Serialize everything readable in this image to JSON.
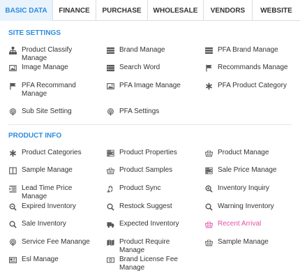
{
  "tabs": [
    {
      "label": "BASIC DATA"
    },
    {
      "label": "FINANCE"
    },
    {
      "label": "PURCHASE"
    },
    {
      "label": "WHOLESALE"
    },
    {
      "label": "VENDORS"
    },
    {
      "label": "WEBSITE"
    }
  ],
  "site_settings": {
    "title": "SITE SETTINGS",
    "items": [
      {
        "label": "Product Classify Manage",
        "icon": "sitemap-icon"
      },
      {
        "label": "Brand Manage",
        "icon": "list-icon"
      },
      {
        "label": "PFA Brand Manage",
        "icon": "list-icon"
      },
      {
        "label": "Image Manage",
        "icon": "image-icon"
      },
      {
        "label": "Search Word",
        "icon": "list-bullet-icon"
      },
      {
        "label": "Recommands Manage",
        "icon": "flag-icon"
      },
      {
        "label": "PFA Recommand Manage",
        "icon": "flag-icon"
      },
      {
        "label": "PFA Image Manage",
        "icon": "image-icon"
      },
      {
        "label": "PFA Product Category",
        "icon": "asterisk-icon"
      },
      {
        "label": "Sub Site Setting",
        "icon": "podcast-icon"
      },
      {
        "label": "PFA Settings",
        "icon": "podcast-icon"
      }
    ]
  },
  "product_info": {
    "title": "PRODUCT INFO",
    "items": [
      {
        "label": "Product Categories",
        "icon": "asterisk-icon"
      },
      {
        "label": "Product Properties",
        "icon": "tasks-icon"
      },
      {
        "label": "Product Manage",
        "icon": "basket-icon"
      },
      {
        "label": "Sample Manage",
        "icon": "columns-icon"
      },
      {
        "label": "Product Samples",
        "icon": "basket-icon"
      },
      {
        "label": "Sale Price Manage",
        "icon": "tasks-icon"
      },
      {
        "label": "Lead Time Price Manage",
        "icon": "list-indent-icon"
      },
      {
        "label": "Product Sync",
        "icon": "recycle-icon"
      },
      {
        "label": "Inventory Inquiry",
        "icon": "search-plus-icon"
      },
      {
        "label": "Expired Inventory",
        "icon": "search-minus-icon"
      },
      {
        "label": "Restock Suggest",
        "icon": "search-icon"
      },
      {
        "label": "Warning Inventory",
        "icon": "search-icon"
      },
      {
        "label": "Sale Inventory",
        "icon": "search-icon"
      },
      {
        "label": "Expected Inventory",
        "icon": "truck-icon"
      },
      {
        "label": "Recent Arrival",
        "icon": "basket-icon"
      },
      {
        "label": "Service Fee Manange",
        "icon": "podcast-icon"
      },
      {
        "label": "Product Require Manage",
        "icon": "map-icon"
      },
      {
        "label": "Sample Manage",
        "icon": "basket-icon"
      },
      {
        "label": "Esl Manage",
        "icon": "id-card-icon"
      },
      {
        "label": "Brand License Fee Manage",
        "icon": "money-icon"
      }
    ]
  },
  "colors": {
    "accent": "#2d8ce0",
    "active_tab_bg": "#e8f3fc",
    "highlight_item": "#e54ea8",
    "text": "#333333"
  }
}
